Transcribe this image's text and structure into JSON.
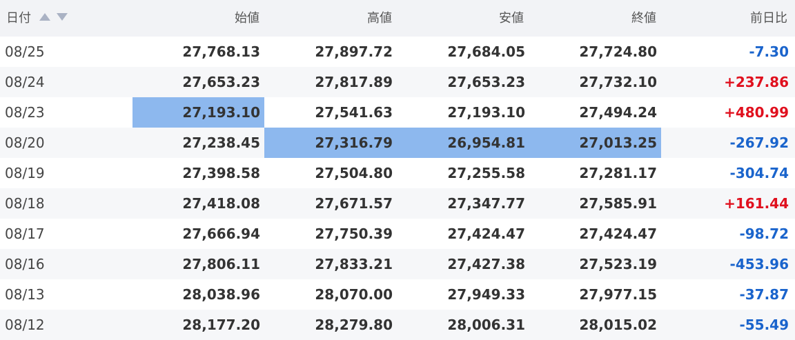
{
  "colors": {
    "negative": "#1a64cc",
    "positive": "#e0101e",
    "highlight": "#8db8ee",
    "header_bg": "#f2f3f6",
    "stripe_bg": "#f6f7f9"
  },
  "header": {
    "date": "日付",
    "open": "始値",
    "high": "高値",
    "low": "安値",
    "close": "終値",
    "change": "前日比",
    "sort_icons": [
      "sort-ascending-icon",
      "sort-descending-icon"
    ]
  },
  "rows": [
    {
      "date": "08/25",
      "open": "27,768.13",
      "high": "27,897.72",
      "low": "27,684.05",
      "close": "27,724.80",
      "change": "-7.30"
    },
    {
      "date": "08/24",
      "open": "27,653.23",
      "high": "27,817.89",
      "low": "27,653.23",
      "close": "27,732.10",
      "change": "+237.86"
    },
    {
      "date": "08/23",
      "open": "27,193.10",
      "high": "27,541.63",
      "low": "27,193.10",
      "close": "27,494.24",
      "change": "+480.99"
    },
    {
      "date": "08/20",
      "open": "27,238.45",
      "high": "27,316.79",
      "low": "26,954.81",
      "close": "27,013.25",
      "change": "-267.92"
    },
    {
      "date": "08/19",
      "open": "27,398.58",
      "high": "27,504.80",
      "low": "27,255.58",
      "close": "27,281.17",
      "change": "-304.74"
    },
    {
      "date": "08/18",
      "open": "27,418.08",
      "high": "27,671.57",
      "low": "27,347.77",
      "close": "27,585.91",
      "change": "+161.44"
    },
    {
      "date": "08/17",
      "open": "27,666.94",
      "high": "27,750.39",
      "low": "27,424.47",
      "close": "27,424.47",
      "change": "-98.72"
    },
    {
      "date": "08/16",
      "open": "27,806.11",
      "high": "27,833.21",
      "low": "27,427.38",
      "close": "27,523.19",
      "change": "-453.96"
    },
    {
      "date": "08/13",
      "open": "28,038.96",
      "high": "28,070.00",
      "low": "27,949.33",
      "close": "27,977.15",
      "change": "-37.87"
    },
    {
      "date": "08/12",
      "open": "28,177.20",
      "high": "28,279.80",
      "low": "28,006.31",
      "close": "28,015.02",
      "change": "-55.49"
    }
  ],
  "selected_cells": [
    {
      "row": 2,
      "column": "open"
    },
    {
      "row": 3,
      "column": "high"
    },
    {
      "row": 3,
      "column": "low"
    },
    {
      "row": 3,
      "column": "close"
    }
  ]
}
